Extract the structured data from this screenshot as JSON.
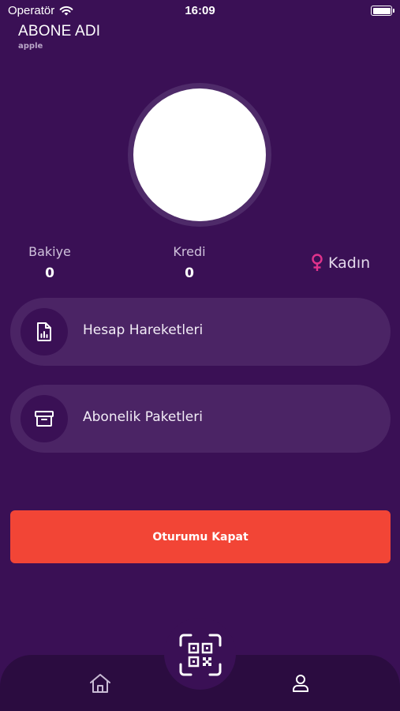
{
  "status_bar": {
    "carrier": "Operatör",
    "time": "16:09"
  },
  "account": {
    "name": "ABONE ADI",
    "sub": "apple"
  },
  "stats": {
    "balance_label": "Bakiye",
    "balance_value": "0",
    "credit_label": "Kredi",
    "credit_value": "0",
    "gender": "Kadın"
  },
  "menu": [
    {
      "label": "Hesap Hareketleri",
      "icon": "file-chart-icon"
    },
    {
      "label": "Abonelik Paketleri",
      "icon": "archive-box-icon"
    }
  ],
  "logout_label": "Oturumu Kapat",
  "tabbar": {
    "items": [
      {
        "icon": "home-icon"
      },
      {
        "icon": "qr-scan-icon"
      },
      {
        "icon": "profile-icon"
      }
    ]
  },
  "colors": {
    "background": "#3a1055",
    "card": "#4b2465",
    "accent_red": "#f24536",
    "gender_pink": "#e0338c",
    "tabbar": "#2b0c40"
  }
}
